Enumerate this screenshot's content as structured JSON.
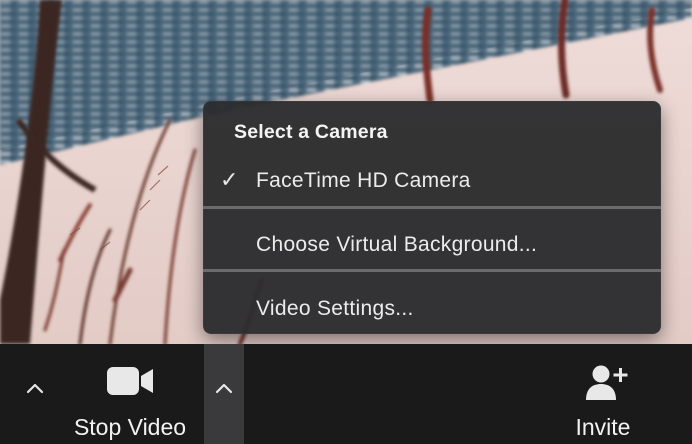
{
  "camera_menu": {
    "header": "Select a Camera",
    "items": [
      {
        "label": "FaceTime HD Camera",
        "checked": true
      },
      {
        "label": "Choose Virtual Background..."
      },
      {
        "label": "Video Settings..."
      }
    ]
  },
  "toolbar": {
    "stop_video_label": "Stop Video",
    "invite_label": "Invite"
  },
  "icons": {
    "audio_options": "chevron-up-icon",
    "video_options": "chevron-up-icon",
    "video": "video-camera-icon",
    "invite": "add-person-icon",
    "check": "checkmark-icon"
  },
  "colors": {
    "menu_bg": "#2c2c2e",
    "toolbar_bg": "#1a1a1a",
    "selected_chevron_bg": "#3a3a3c",
    "text": "#ececec"
  }
}
